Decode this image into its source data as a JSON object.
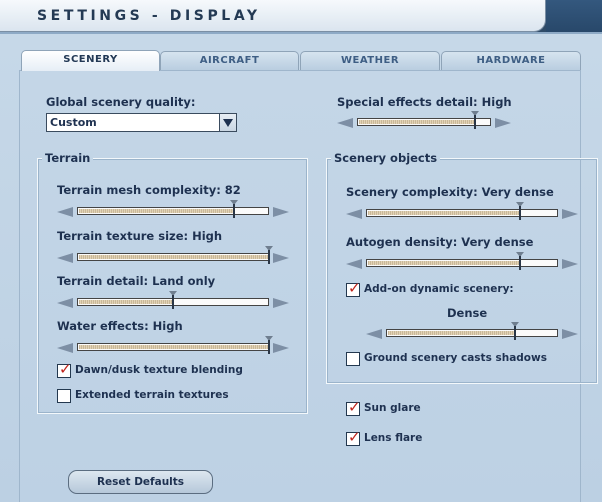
{
  "window": {
    "title": "SETTINGS - DISPLAY"
  },
  "tabs": [
    {
      "label": "SCENERY",
      "active": true
    },
    {
      "label": "AIRCRAFT",
      "active": false
    },
    {
      "label": "WEATHER",
      "active": false
    },
    {
      "label": "HARDWARE",
      "active": false
    }
  ],
  "global_quality": {
    "label": "Global scenery quality:",
    "value": "Custom"
  },
  "special_effects": {
    "label": "Special effects detail: High",
    "level": 0.88
  },
  "terrain": {
    "title": "Terrain",
    "mesh": {
      "label": "Terrain mesh complexity: 82",
      "level": 0.82
    },
    "texture": {
      "label": "Terrain texture size: High",
      "level": 1.0
    },
    "detail": {
      "label": "Terrain detail: Land only",
      "level": 0.5
    },
    "water": {
      "label": "Water effects: High",
      "level": 1.0
    },
    "dawn_dusk": {
      "label": "Dawn/dusk texture blending",
      "checked": true
    },
    "extended": {
      "label": "Extended terrain textures",
      "checked": false
    }
  },
  "scenery_objects": {
    "title": "Scenery objects",
    "complexity": {
      "label": "Scenery complexity: Very dense",
      "level": 0.8
    },
    "autogen": {
      "label": "Autogen density: Very dense",
      "level": 0.8
    },
    "addon": {
      "label": "Add-on dynamic scenery:",
      "checked": true
    },
    "addon_value": "Dense",
    "addon_level": 0.75,
    "shadows": {
      "label": "Ground scenery casts shadows",
      "checked": false
    }
  },
  "sun_glare": {
    "label": "Sun glare",
    "checked": true
  },
  "lens_flare": {
    "label": "Lens flare",
    "checked": true
  },
  "reset": {
    "label": "Reset Defaults"
  },
  "colors": {
    "check": "#c0241c",
    "panel": "#c4d6e7",
    "frame": "#2f4b68"
  }
}
